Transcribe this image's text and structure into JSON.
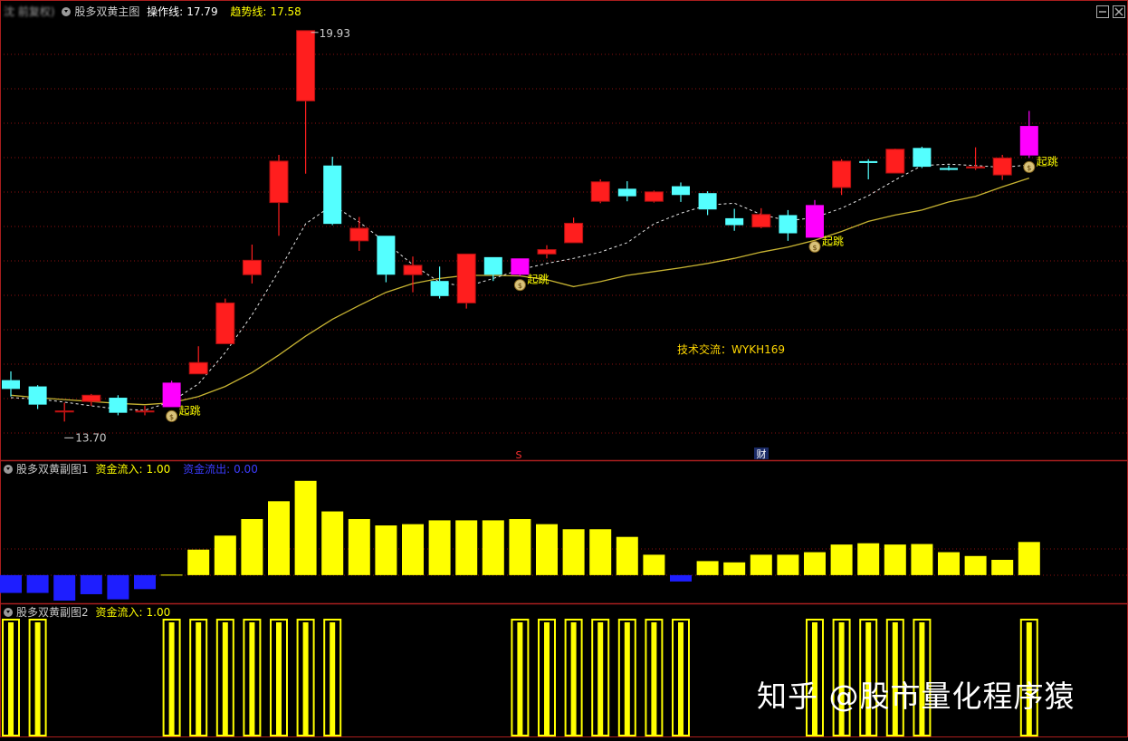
{
  "header_main": {
    "blurred_prefix": "沈 前复权)",
    "indicator_name": "股多双黄主图",
    "op_label": "操作线:",
    "op_value": "17.79",
    "trend_label": "趋势线:",
    "trend_value": "17.58"
  },
  "header_sub1": {
    "indicator_name": "股多双黄副图1",
    "inflow_label": "资金流入:",
    "inflow_value": "1.00",
    "outflow_label": "资金流出:",
    "outflow_value": "0.00"
  },
  "header_sub2": {
    "indicator_name": "股多双黄副图2",
    "inflow_label": "资金流入:",
    "inflow_value": "1.00"
  },
  "annotations": {
    "high_label": "19.93",
    "low_label": "13.70",
    "signal_text": "起跳",
    "tech_contact": "技术交流：WYKH169",
    "marker_s": "S",
    "marker_cai": "财"
  },
  "watermark": "知乎 @股市量化程序猿",
  "colors": {
    "background": "#000000",
    "bull_candle": "#ff1e1e",
    "bear_candle": "#54ffff",
    "signal_candle": "#ff00ff",
    "trend_line": "#c8b432",
    "op_line": "#e6e6e6",
    "inflow_bar": "#ffff00",
    "outflow_bar": "#1e1eff",
    "panel_divider": "#aa1e1e",
    "grid": "#8c0f0f"
  },
  "chart_data": [
    {
      "type": "candlestick",
      "title": "股多双黄主图",
      "ylim": [
        13.2,
        20.1
      ],
      "candles": [
        {
          "o": 14.36,
          "c": 14.22,
          "h": 14.5,
          "l": 14.1
        },
        {
          "o": 14.26,
          "c": 13.97,
          "h": 14.28,
          "l": 13.9
        },
        {
          "o": 13.87,
          "c": 13.87,
          "h": 14.0,
          "l": 13.7
        },
        {
          "o": 14.02,
          "c": 14.12,
          "h": 14.14,
          "l": 13.95
        },
        {
          "o": 14.08,
          "c": 13.84,
          "h": 14.12,
          "l": 13.8
        },
        {
          "o": 13.87,
          "c": 13.87,
          "h": 13.95,
          "l": 13.8
        },
        {
          "o": 13.93,
          "c": 14.32,
          "h": 14.35,
          "l": 13.93
        },
        {
          "o": 14.46,
          "c": 14.64,
          "h": 14.9,
          "l": 14.46
        },
        {
          "o": 14.94,
          "c": 15.59,
          "h": 15.66,
          "l": 14.94
        },
        {
          "o": 16.04,
          "c": 16.27,
          "h": 16.52,
          "l": 15.9
        },
        {
          "o": 17.19,
          "c": 17.85,
          "h": 17.95,
          "l": 16.66
        },
        {
          "o": 18.81,
          "c": 19.93,
          "h": 19.93,
          "l": 17.65
        },
        {
          "o": 17.78,
          "c": 16.85,
          "h": 17.92,
          "l": 16.83
        },
        {
          "o": 16.58,
          "c": 16.78,
          "h": 16.96,
          "l": 16.42
        },
        {
          "o": 16.66,
          "c": 16.04,
          "h": 16.66,
          "l": 15.92
        },
        {
          "o": 16.04,
          "c": 16.19,
          "h": 16.33,
          "l": 15.76
        },
        {
          "o": 15.94,
          "c": 15.7,
          "h": 16.17,
          "l": 15.66
        },
        {
          "o": 15.59,
          "c": 16.37,
          "h": 16.37,
          "l": 15.5
        },
        {
          "o": 16.32,
          "c": 16.04,
          "h": 16.32,
          "l": 15.94
        },
        {
          "o": 16.04,
          "c": 16.3,
          "h": 16.3,
          "l": 16.02
        },
        {
          "o": 16.37,
          "c": 16.44,
          "h": 16.51,
          "l": 16.3
        },
        {
          "o": 16.55,
          "c": 16.86,
          "h": 16.95,
          "l": 16.55
        },
        {
          "o": 17.21,
          "c": 17.52,
          "h": 17.56,
          "l": 17.18
        },
        {
          "o": 17.41,
          "c": 17.29,
          "h": 17.53,
          "l": 17.21
        },
        {
          "o": 17.21,
          "c": 17.36,
          "h": 17.38,
          "l": 17.19
        },
        {
          "o": 17.45,
          "c": 17.31,
          "h": 17.51,
          "l": 17.2
        },
        {
          "o": 17.34,
          "c": 17.08,
          "h": 17.37,
          "l": 16.99
        },
        {
          "o": 16.94,
          "c": 16.83,
          "h": 17.09,
          "l": 16.74
        },
        {
          "o": 16.8,
          "c": 17.0,
          "h": 17.1,
          "l": 16.78
        },
        {
          "o": 16.99,
          "c": 16.7,
          "h": 17.07,
          "l": 16.58
        },
        {
          "o": 17.15,
          "c": 16.63,
          "h": 17.23,
          "l": 16.63
        },
        {
          "o": 17.43,
          "c": 17.85,
          "h": 17.88,
          "l": 17.31
        },
        {
          "o": 17.85,
          "c": 17.82,
          "h": 17.88,
          "l": 17.56
        },
        {
          "o": 17.66,
          "c": 18.04,
          "h": 18.05,
          "l": 17.66
        },
        {
          "o": 18.06,
          "c": 17.76,
          "h": 18.08,
          "l": 17.74
        },
        {
          "o": 17.74,
          "c": 17.71,
          "h": 17.78,
          "l": 17.7
        },
        {
          "o": 17.74,
          "c": 17.76,
          "h": 18.07,
          "l": 17.71
        },
        {
          "o": 17.63,
          "c": 17.9,
          "h": 17.95,
          "l": 17.55
        },
        {
          "o": 17.94,
          "c": 18.41,
          "h": 18.65,
          "l": 17.9
        }
      ],
      "signal_candles": [
        6,
        19,
        30,
        38
      ],
      "op_line": [
        14.08,
        14.06,
        14.01,
        13.95,
        13.9,
        13.88,
        14.02,
        14.3,
        14.8,
        15.4,
        16.1,
        16.85,
        17.15,
        16.88,
        16.55,
        16.2,
        15.92,
        15.85,
        15.98,
        16.12,
        16.22,
        16.3,
        16.4,
        16.55,
        16.85,
        17.02,
        17.15,
        17.18,
        17.0,
        16.9,
        16.95,
        17.1,
        17.3,
        17.55,
        17.78,
        17.8,
        17.78,
        17.75,
        17.79
      ],
      "trend_line": [
        14.12,
        14.08,
        14.05,
        14.02,
        13.99,
        13.97,
        14.0,
        14.1,
        14.26,
        14.48,
        14.76,
        15.06,
        15.33,
        15.55,
        15.76,
        15.9,
        15.98,
        16.03,
        16.03,
        16.02,
        15.96,
        15.85,
        15.93,
        16.03,
        16.09,
        16.15,
        16.22,
        16.3,
        16.4,
        16.48,
        16.59,
        16.73,
        16.89,
        16.99,
        17.07,
        17.2,
        17.29,
        17.44,
        17.58
      ]
    },
    {
      "type": "bar",
      "title": "股多双黄副图1",
      "ylim": [
        -1.0,
        3.8
      ],
      "values": [
        -0.7,
        -0.7,
        -1.0,
        -0.75,
        -0.95,
        -0.55,
        0.05,
        1.0,
        1.55,
        2.2,
        2.9,
        3.7,
        2.5,
        2.2,
        1.95,
        2.0,
        2.15,
        2.15,
        2.15,
        2.2,
        2.0,
        1.8,
        1.8,
        1.5,
        0.8,
        -0.25,
        0.55,
        0.5,
        0.8,
        0.8,
        0.9,
        1.2,
        1.25,
        1.2,
        1.22,
        0.9,
        0.75,
        0.6,
        1.3
      ]
    },
    {
      "type": "bar",
      "title": "股多双黄副图2",
      "ylim": [
        0,
        1
      ],
      "values": [
        1,
        1,
        0,
        0,
        0,
        0,
        1,
        1,
        1,
        1,
        1,
        1,
        1,
        0,
        0,
        0,
        0,
        0,
        0,
        1,
        1,
        1,
        1,
        1,
        1,
        1,
        0,
        0,
        0,
        0,
        1,
        1,
        1,
        1,
        1,
        0,
        0,
        0,
        1
      ]
    }
  ]
}
